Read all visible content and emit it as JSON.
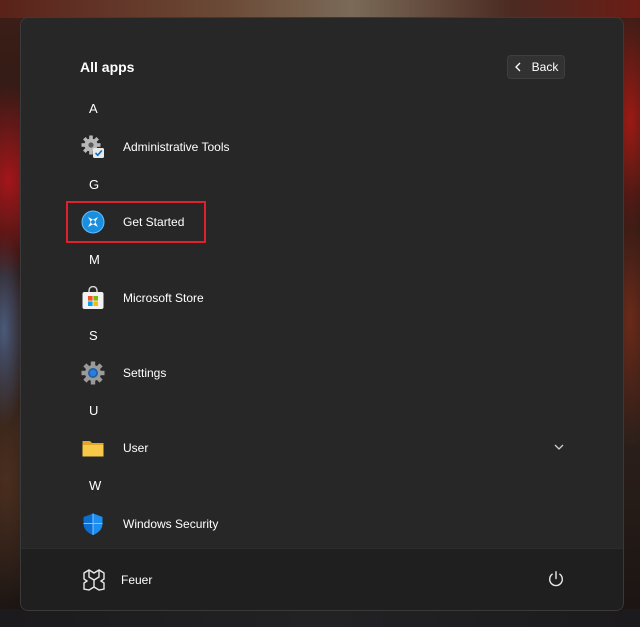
{
  "menu": {
    "title": "All apps",
    "back_label": "Back"
  },
  "sections": [
    {
      "letter": "A",
      "apps": [
        {
          "label": "Administrative Tools",
          "icon": "administrative-tools-icon"
        }
      ]
    },
    {
      "letter": "G",
      "apps": [
        {
          "label": "Get Started",
          "icon": "get-started-icon"
        }
      ]
    },
    {
      "letter": "M",
      "apps": [
        {
          "label": "Microsoft Store",
          "icon": "microsoft-store-icon"
        }
      ]
    },
    {
      "letter": "S",
      "apps": [
        {
          "label": "Settings",
          "icon": "settings-gear-icon"
        }
      ]
    },
    {
      "letter": "U",
      "apps": [
        {
          "label": "User",
          "icon": "folder-icon"
        }
      ]
    },
    {
      "letter": "W",
      "apps": [
        {
          "label": "Windows Security",
          "icon": "windows-security-shield-icon"
        }
      ]
    }
  ],
  "footer": {
    "user_name": "Feuer",
    "user_icon": "user-account-icon",
    "power_icon": "power-icon"
  },
  "colors": {
    "panel": "#272727",
    "footer": "#1f1f1f",
    "highlight_box": "#e0202a",
    "accent_blue": "#0078d4"
  }
}
